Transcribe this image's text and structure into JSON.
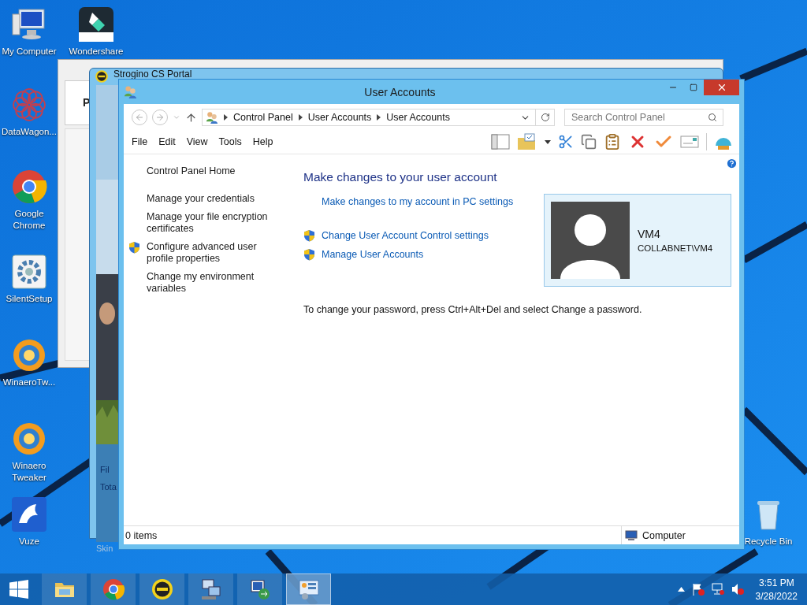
{
  "desktop_icons": [
    {
      "label": "My Computer",
      "kind": "computer"
    },
    {
      "label": "Wondershare",
      "kind": "editor"
    },
    {
      "label": "DataWagon...",
      "kind": "flower"
    },
    {
      "label": "Google Chrome",
      "kind": "browser"
    },
    {
      "label": "SilentSetup",
      "kind": "setup"
    },
    {
      "label": "WinaeroTw...",
      "kind": "tweaker"
    },
    {
      "label": "Winaero Tweaker",
      "kind": "tweaker"
    },
    {
      "label": "Vuze",
      "kind": "frog"
    },
    {
      "label": "Recycle Bin",
      "kind": "bin"
    }
  ],
  "back_window": {
    "text": "P"
  },
  "portal_window": {
    "title": "Strogino CS Portal",
    "labels": [
      "Fil",
      "Tota"
    ],
    "footer": "Skin"
  },
  "window": {
    "title": "User Accounts"
  },
  "nav": {
    "breadcrumb": [
      "Control Panel",
      "User Accounts",
      "User Accounts"
    ],
    "search": {
      "placeholder": "Search Control Panel"
    }
  },
  "menu": [
    "File",
    "Edit",
    "View",
    "Tools",
    "Help"
  ],
  "sidebar": {
    "home": "Control Panel Home",
    "items": [
      {
        "label": "Manage your credentials",
        "shield": false
      },
      {
        "label": "Manage your file encryption certificates",
        "shield": false
      },
      {
        "label": "Configure advanced user profile properties",
        "shield": true
      },
      {
        "label": "Change my environment variables",
        "shield": false
      }
    ]
  },
  "main": {
    "heading": "Make changes to your user account",
    "links": [
      {
        "label": "Make changes to my account in PC settings",
        "shield": false
      },
      {
        "label": "Change User Account Control settings",
        "shield": true
      },
      {
        "label": "Manage User Accounts",
        "shield": true
      }
    ],
    "note": "To change your password, press Ctrl+Alt+Del and select Change a password."
  },
  "user": {
    "name": "VM4",
    "account": "COLLABNET\\VM4"
  },
  "status_bar": {
    "count": "0 items",
    "zone": "Computer"
  },
  "taskbar": {
    "buttons": [
      {
        "kind": "folder",
        "selected": false
      },
      {
        "kind": "browser",
        "selected": false
      },
      {
        "kind": "portal",
        "selected": false
      },
      {
        "kind": "network",
        "selected": false
      },
      {
        "kind": "remote",
        "selected": false
      },
      {
        "kind": "panel",
        "selected": true
      }
    ],
    "time": "3:51 PM",
    "date": "3/28/2022"
  }
}
